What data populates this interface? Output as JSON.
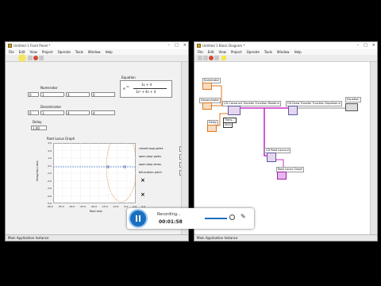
{
  "front_panel": {
    "title": "Untitled 1 Front Panel *",
    "menu": [
      "File",
      "Edit",
      "View",
      "Project",
      "Operate",
      "Tools",
      "Window",
      "Help"
    ],
    "numerator_label": "Numerator",
    "numerator_index": "0",
    "numerator_values": [
      "1",
      "4",
      "0"
    ],
    "denominator_label": "Denominator",
    "denominator_index": "0",
    "denominator_values": [
      "1",
      "4",
      "4"
    ],
    "delay_label": "Delay",
    "delay_value": "1.00",
    "equation_label": "Equation",
    "equation_num": "1s + 4",
    "equation_den": "1s² + 4s + 4",
    "equation_prefix": "e",
    "equation_exp": "-1s",
    "graph_title": "Root Locus Graph",
    "x_axis_label": "Real axis",
    "y_axis_label": "Imaginary axis",
    "x_ticks": [
      "-40.0",
      "-35.0",
      "-30.0",
      "-25.0",
      "-20.0",
      "-15.0",
      "-10.0",
      "-5.0",
      "0.0",
      "5.0"
    ],
    "y_ticks": [
      "3.0",
      "2.0",
      "1.0",
      "0.0",
      "-1.0",
      "-2.0",
      "-3.0",
      "-4.0",
      "-5.0"
    ],
    "legend": [
      "closed-loop poles",
      "open-loop poles",
      "open-loop zeros",
      "bifurcation point"
    ],
    "status_text": "Main Application Instance"
  },
  "block_diagram": {
    "title": "Untitled 1 Block Diagram *",
    "menu": [
      "File",
      "Edit",
      "View",
      "Project",
      "Operate",
      "Tools",
      "Window",
      "Help"
    ],
    "numerator_terminal": "Numerator",
    "denominator_terminal": "Denominator",
    "delay_terminal": "Delay",
    "tf_model_vi": "CD Construct Transfer Function Model.vi",
    "draw_tf_vi": "CD Draw Transfer Function Equation.vi",
    "equation_terminal": "Equation",
    "root_locus_vi": "CD Root Locus.vi",
    "root_locus_graph_terminal": "Root Locus Graph",
    "tf_type_label": "Trans...",
    "tf_type_value": "SISO",
    "status_text": "Main Application Instance"
  },
  "recorder": {
    "status": "Recording...",
    "time": "00:01:58"
  },
  "colors": {
    "wire_pink": "#c832c8",
    "wire_orange": "#e07820",
    "highlight_yellow": "#f5e64a",
    "record_blue": "#1a6fc0"
  }
}
